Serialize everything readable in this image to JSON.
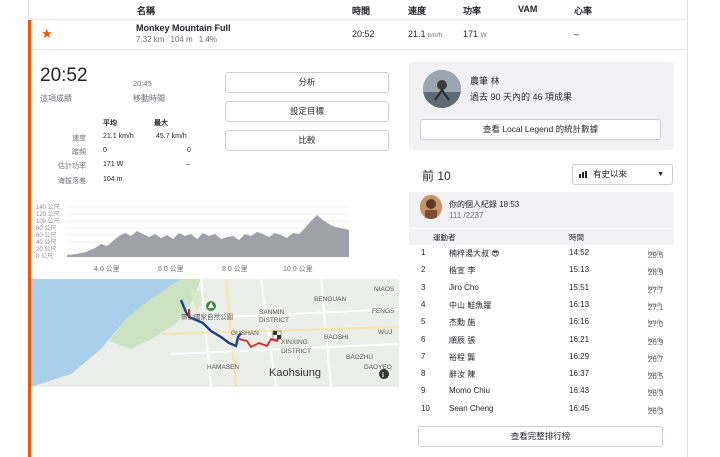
{
  "table": {
    "headers": {
      "name": "名稱",
      "time": "時間",
      "speed": "速度",
      "power": "功率",
      "vam": "VAM",
      "hr": "心率"
    },
    "segment": {
      "name": "Monkey Mountain Full",
      "distance": "7.32 km",
      "elev": "104 m",
      "grade": "1.4%",
      "time": "20:52",
      "speed": "21.1",
      "speed_unit": "km/h",
      "power": "171",
      "power_unit": "W",
      "hr": "–"
    }
  },
  "effort": {
    "elapsed_time": "20:52",
    "elapsed_label": "這項成績",
    "moving_time": "20:45",
    "moving_label": "移動時間",
    "col_avg": "平均",
    "col_max": "最大",
    "stats": [
      {
        "label": "速度",
        "avg": "21.1 km/h",
        "max": "45.7 km/h"
      },
      {
        "label": "踏頻",
        "avg": "0",
        "max": "0"
      },
      {
        "label": "估計功率",
        "avg": "171 W",
        "max": "–"
      },
      {
        "label": "海拔落差",
        "avg": "104 m",
        "max": ""
      }
    ],
    "buttons": {
      "share": "分析",
      "set_goal": "設定目標",
      "compare": "比較"
    }
  },
  "elevation": {
    "y_ticks": [
      "140 公尺",
      "120 公尺",
      "100 公尺",
      "80 公尺",
      "60 公尺",
      "40 公尺",
      "20 公尺",
      "0 公尺"
    ],
    "x_ticks": [
      "4.0 公里",
      "6.0 公里",
      "8.0 公里",
      "10.0 公里"
    ]
  },
  "map": {
    "labels": {
      "park": "壽山國家自然公園",
      "benguan": "BENGUAN",
      "sanmin": "SANMIN",
      "district": "DISTRICT",
      "gushan": "GUSHAN",
      "xinxing": "XINXING",
      "xinxing_district": "DISTRICT",
      "baoshi": "BAOSHI",
      "baozhu": "BAOZHU",
      "hamasen": "HAMASEN",
      "kaohsiung": "Kaohsiung",
      "niaosong": "NIAOS",
      "fengshan": "FENGS",
      "wuj": "WUJ",
      "daoyen": "DAOYEO"
    }
  },
  "local_legend": {
    "name": "農筆 林",
    "desc": "過去 90 天內的 46 項成果",
    "button": "查看 Local Legend 的統計數據"
  },
  "leaderboard": {
    "title": "前 10",
    "filter": "有史以來",
    "pr_title": "你的個人紀錄",
    "pr_time": "18:53",
    "pr_rank": "111 /2237",
    "col_athlete": "運動者",
    "col_time": "時間",
    "rows": [
      {
        "rank": "1",
        "name": "楠梓湯大叔 😎",
        "time": "14:52",
        "speed": "29.6"
      },
      {
        "rank": "2",
        "name": "楷宣 李",
        "time": "15:13",
        "speed": "28.9"
      },
      {
        "rank": "3",
        "name": "Jiro Cho",
        "time": "15:51",
        "speed": "27.7"
      },
      {
        "rank": "4",
        "name": "中山 鮭魚躍",
        "time": "16:13",
        "speed": "27.1"
      },
      {
        "rank": "5",
        "name": "杰勳 施",
        "time": "16:16",
        "speed": "27.0"
      },
      {
        "rank": "6",
        "name": "順辰 張",
        "time": "16:21",
        "speed": "26.9"
      },
      {
        "rank": "7",
        "name": "裕程 龔",
        "time": "16:29",
        "speed": "26.7"
      },
      {
        "rank": "8",
        "name": "辭汝 陳",
        "time": "16:37",
        "speed": "26.5"
      },
      {
        "rank": "9",
        "name": "Momo Chiu",
        "time": "16:43",
        "speed": "26.3"
      },
      {
        "rank": "10",
        "name": "Sean Cheng",
        "time": "16:45",
        "speed": "26.3"
      }
    ],
    "speed_unit": "km/h",
    "full_button": "查看完整排行榜"
  }
}
